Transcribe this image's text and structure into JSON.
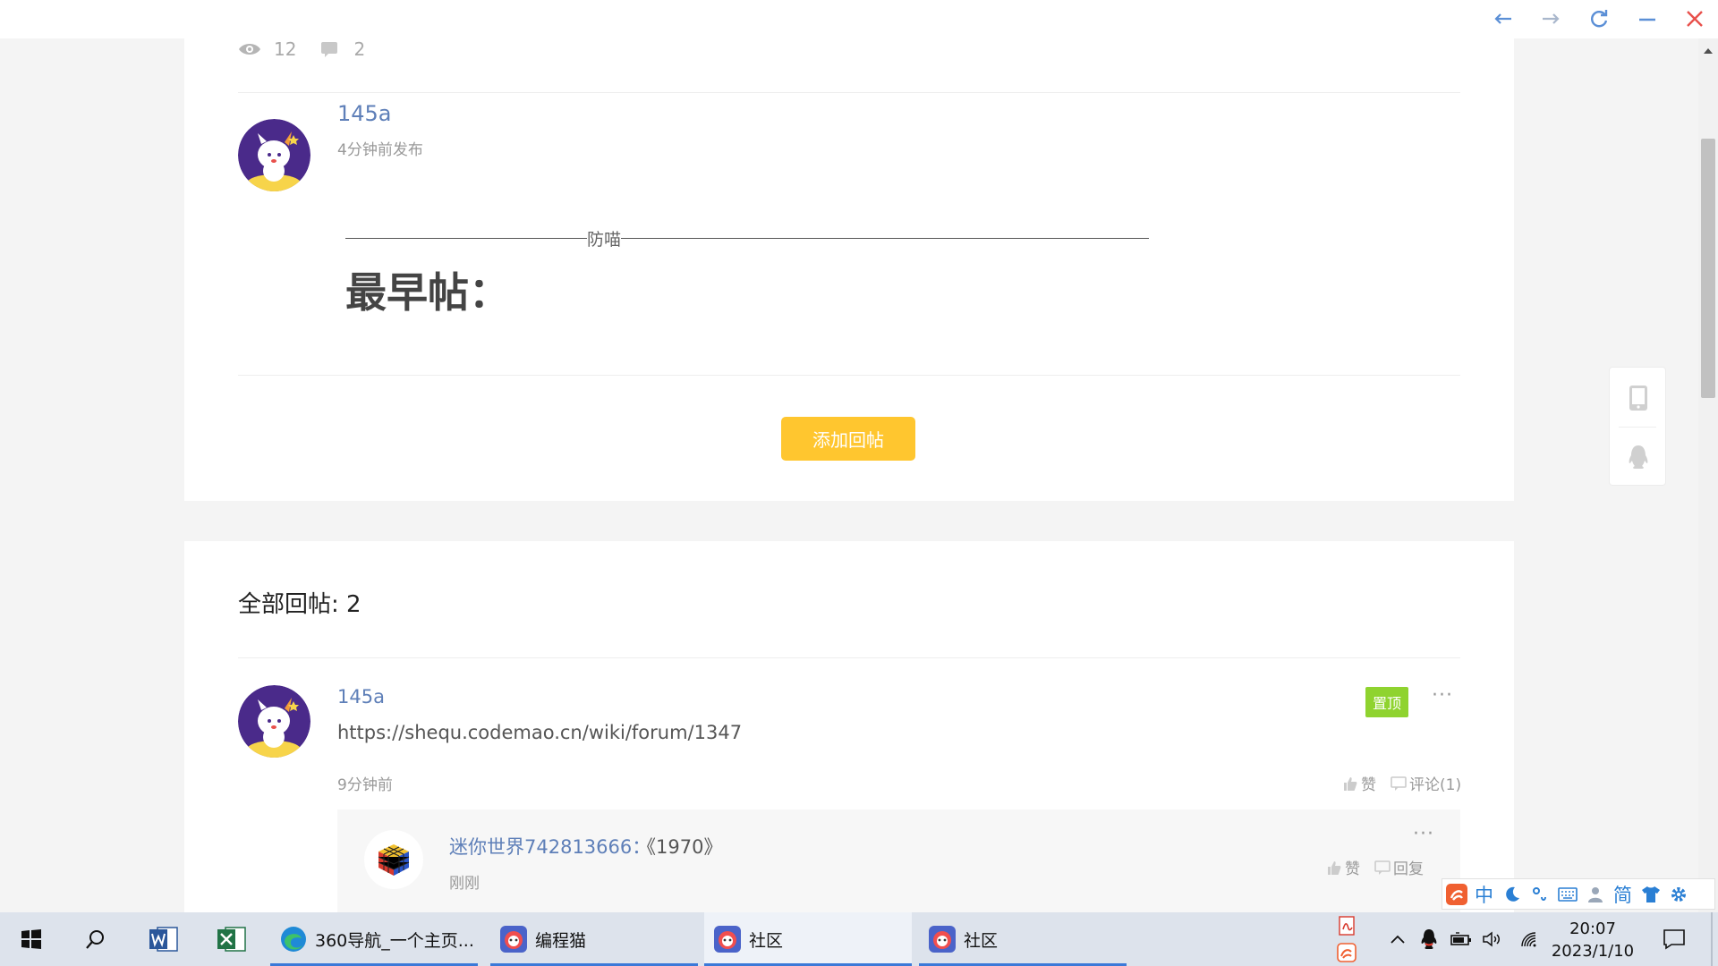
{
  "window": {
    "buttons": [
      "back-icon",
      "forward-icon",
      "refresh-icon",
      "minimize-icon",
      "close-icon"
    ],
    "accent": "#5b8fd6",
    "close_color": "#e8504b"
  },
  "post": {
    "views": "12",
    "comments": "2",
    "author": "145a",
    "published": "4分钟前发布",
    "line_text": "防喵",
    "heading": "最早帖：",
    "add_reply_label": "添加回帖"
  },
  "replies": {
    "title": "全部回帖: 2",
    "first": {
      "author": "145a",
      "pinned_label": "置顶",
      "text": "https://shequ.codemao.cn/wiki/forum/1347",
      "time": "9分钟前",
      "like_label": "赞",
      "comment_label": "评论(1)",
      "comment": {
        "author": "迷你世界742813666",
        "separator": "：",
        "text": "《1970》",
        "time": "刚刚",
        "like_label": "赞",
        "reply_label": "回复"
      }
    }
  },
  "ime": {
    "items": [
      "中",
      "简"
    ]
  },
  "taskbar": {
    "apps": [
      {
        "label": "360导航_一个主页..."
      },
      {
        "label": "编程猫"
      },
      {
        "label": "社区"
      },
      {
        "label": "社区"
      }
    ],
    "time": "20:07",
    "date": "2023/1/10"
  },
  "colors": {
    "accent_yellow": "#ffc62f",
    "pinned_green": "#8fd32f",
    "link_blue": "#5e7fb8"
  }
}
